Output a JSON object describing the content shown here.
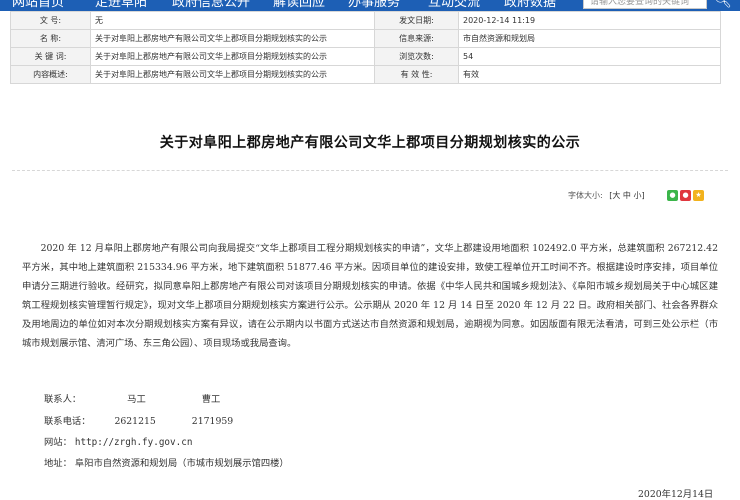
{
  "nav": {
    "items": [
      "网站首页",
      "走进阜阳",
      "政府信息公开",
      "解读回应",
      "办事服务",
      "互动交流",
      "政府数据"
    ],
    "search_placeholder": "请输入您要查询的关键词",
    "search_icon": "search-icon"
  },
  "info": {
    "doc_no_label": "文    号:",
    "doc_no": "无",
    "publish_date_label": "发文日期:",
    "publish_date": "2020-12-14 11:19",
    "name_label": "名    称:",
    "name": "关于对阜阳上郡房地产有限公司文华上郡项目分期规划核实的公示",
    "source_label": "信息来源:",
    "source": "市自然资源和规划局",
    "keywords_label": "关 键 词:",
    "keywords": "关于对阜阳上郡房地产有限公司文华上郡项目分期规划核实的公示",
    "views_label": "浏览次数:",
    "views": "54",
    "summary_label": "内容概述:",
    "summary": "关于对阜阳上郡房地产有限公司文华上郡项目分期规划核实的公示",
    "validity_label": "有 效 性:",
    "validity": "有效"
  },
  "article": {
    "title": "关于对阜阳上郡房地产有限公司文华上郡项目分期规划核实的公示",
    "font_size_label": "字体大小:",
    "font_size_options": "[大 中 小]",
    "share_icons": [
      "wechat-icon",
      "weibo-icon",
      "qzone-icon"
    ],
    "body": "2020 年 12 月阜阳上郡房地产有限公司向我局提交“文华上郡项目工程分期规划核实的申请”，文华上郡建设用地面积 102492.0 平方米，总建筑面积 267212.42 平方米，其中地上建筑面积 215334.96 平方米，地下建筑面积 51877.46 平方米。因项目单位的建设安排，致使工程单位开工时间不齐。根据建设时序安排，项目单位申请分三期进行验收。经研究，拟同意阜阳上郡房地产有限公司对该项目分期规划核实的申请。依据《中华人民共和国城乡规划法》、《阜阳市城乡规划局关于中心城区建筑工程规划核实管理暂行规定》，现对文华上郡项目分期规划核实方案进行公示。公示期从 2020 年 12 月 14 日至 2020 年 12 月 22 日。政府相关部门、社会各界群众及用地周边的单位如对本次分期规划核实方案有异议，请在公示期内以书面方式送达市自然资源和规划局，逾期视为同意。如因版面有限无法看清，可到三处公示栏（市城市规划展示馆、清河广场、东三角公园）、项目现场或我局查询。",
    "contact_label": "联系人：",
    "contact_person_1": "马工",
    "contact_person_2": "曹工",
    "phone_label": "联系电话：",
    "phone_1": "2621215",
    "phone_2": "2171959",
    "website_label": "网站：",
    "website": "http://zrgh.fy.gov.cn",
    "address_label": "地址：",
    "address": "阜阳市自然资源和规划局（市城市规划展示馆四楼）",
    "date": "2020年12月14日"
  },
  "colors": {
    "nav_bg": "#1d5fb5",
    "wechat": "#3bb54a",
    "weibo": "#e0373e",
    "qzone": "#f2b21c"
  }
}
